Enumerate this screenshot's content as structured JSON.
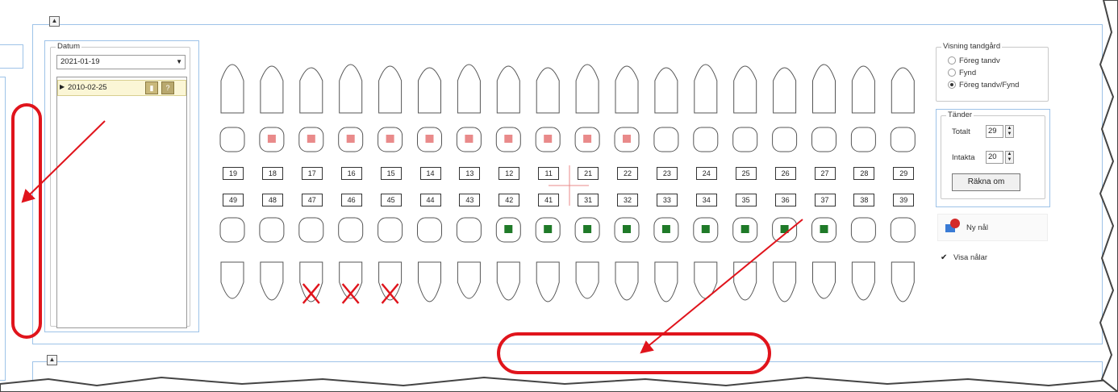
{
  "datum": {
    "legend": "Datum",
    "selected_date": "2021-01-19",
    "entry_date": "2010-02-25",
    "entry_icon_a": "tooth-icon",
    "entry_icon_b": "question-icon"
  },
  "teeth": {
    "upper_numbers": [
      "19",
      "18",
      "17",
      "16",
      "15",
      "14",
      "13",
      "12",
      "11",
      "21",
      "22",
      "23",
      "24",
      "25",
      "26",
      "27",
      "28",
      "29"
    ],
    "lower_numbers": [
      "49",
      "48",
      "47",
      "46",
      "45",
      "44",
      "43",
      "42",
      "41",
      "31",
      "32",
      "33",
      "34",
      "35",
      "36",
      "37",
      "38",
      "39"
    ],
    "upper_fill_color": "#e98a8a",
    "lower_fill_color": "#1f7a28",
    "extraction_color": "#e0141c"
  },
  "visning": {
    "legend": "Visning tandgård",
    "options": [
      "Föreg tandv",
      "Fynd",
      "Föreg tandv/Fynd"
    ],
    "selected_index": 2
  },
  "tander": {
    "legend": "Tänder",
    "totalt_label": "Totalt",
    "totalt_value": "29",
    "intakta_label": "Intakta",
    "intakta_value": "20",
    "recalc_button": "Räkna om"
  },
  "ny_nal": {
    "label": "Ny nål",
    "icon": "pin-icon"
  },
  "visa_nalar": {
    "label": "Visa nålar",
    "checked": true
  },
  "annotation_color": "#e0141c"
}
